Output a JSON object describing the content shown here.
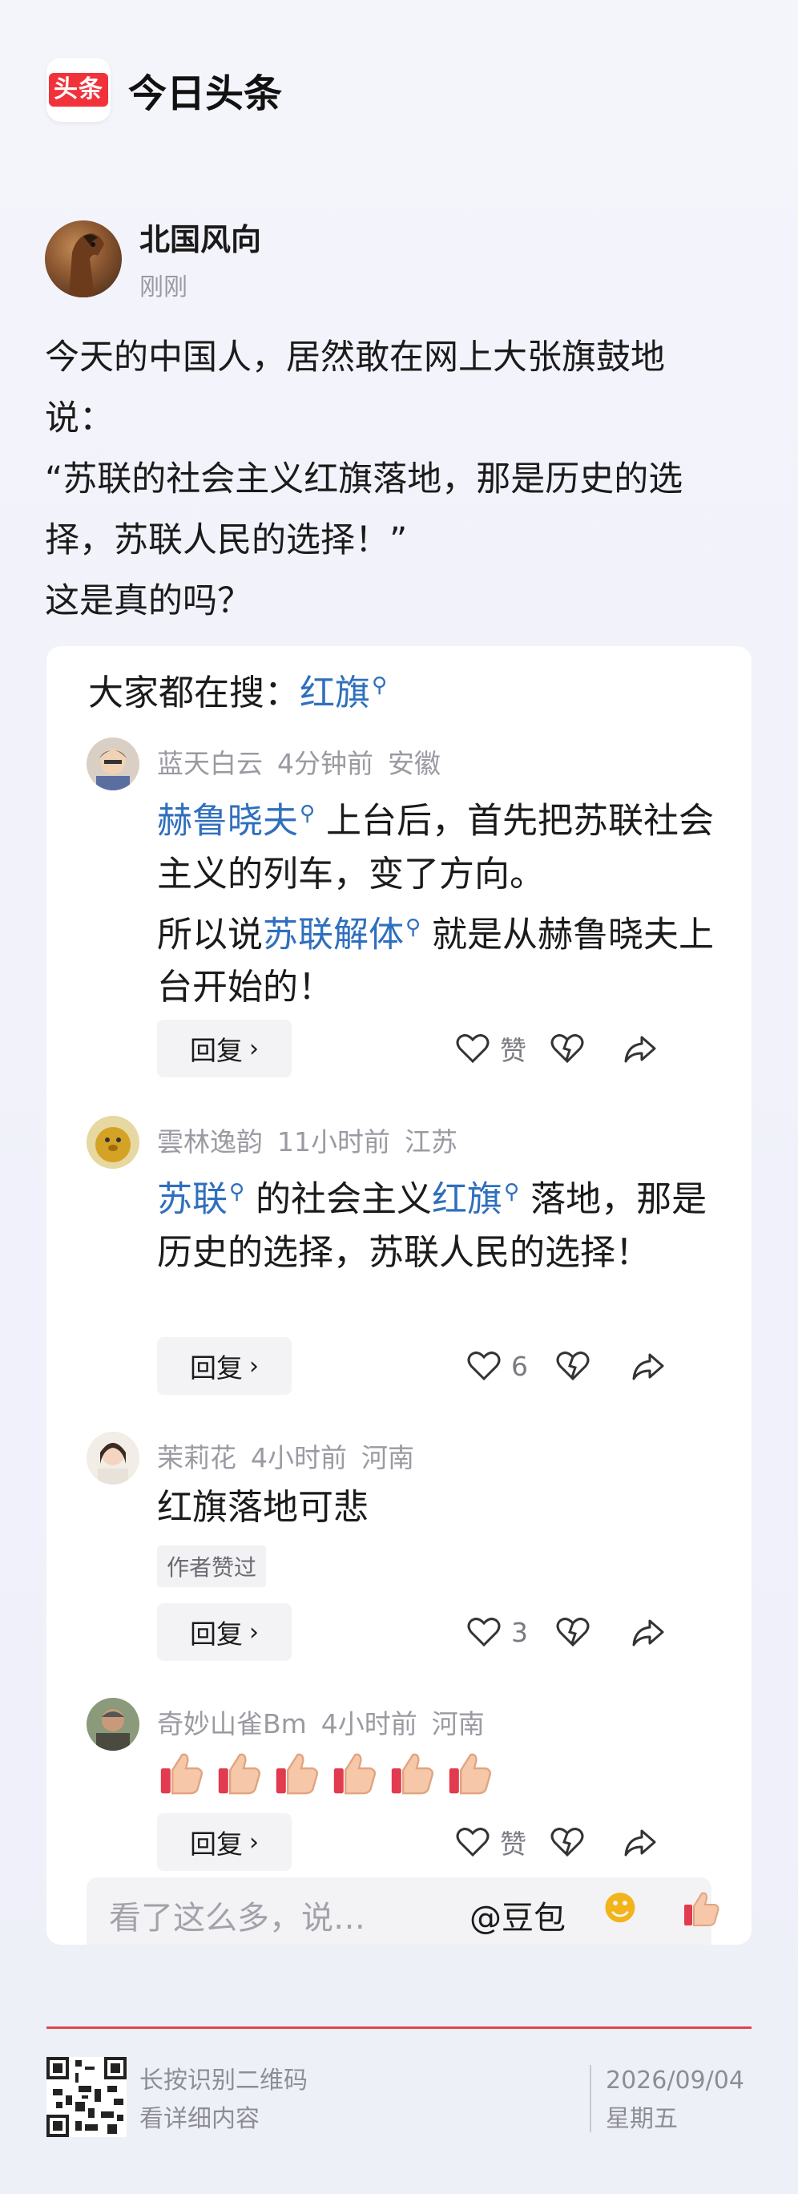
{
  "header": {
    "logo_text": "头条",
    "app_name": "今日头条"
  },
  "post": {
    "author_name": "北国风向",
    "time": "刚刚",
    "text": "今天的中国人，居然敢在网上大张旗鼓地\n说：\n“苏联的社会主义红旗落地，那是历史的选\n择，苏联人民的选择！”\n这是真的吗？"
  },
  "search": {
    "prefix": "大家都在搜：",
    "keyword": "红旗"
  },
  "comments": [
    {
      "user": "蓝天白云",
      "time": "4分钟前",
      "location": "安徽",
      "kw1": "赫鲁晓夫",
      "text1": " 上台后，首先把苏联社会主义的列车，变了方向。",
      "text2": "所以说",
      "kw2": "苏联解体",
      "text3": " 就是从赫鲁晓夫上台开始的！",
      "reply": "回复",
      "like": "赞"
    },
    {
      "user": "雲林逸韵",
      "time": "11小时前",
      "location": "江苏",
      "kw1": "苏联",
      "text1": " 的社会主义",
      "kw2": "红旗",
      "text2": " 落地，那是历史的选择，苏联人民的选择！",
      "reply": "回复",
      "like": "6"
    },
    {
      "user": "茉莉花",
      "time": "4小时前",
      "location": "河南",
      "text": "红旗落地可悲",
      "badge": "作者赞过",
      "reply": "回复",
      "like": "3"
    },
    {
      "user": "奇妙山雀Bm",
      "time": "4小时前",
      "location": "河南",
      "thumbs_count": 6,
      "reply": "回复",
      "like": "赞"
    }
  ],
  "input": {
    "placeholder": "看了这么多，说…",
    "mention": "@豆包"
  },
  "footer": {
    "qr_line1": "长按识别二维码",
    "qr_line2": "看详细内容",
    "date": "2026/09/04",
    "weekday": "星期五"
  },
  "colors": {
    "keyword": "#2f6fbd",
    "brand_red": "#f2323a",
    "divider": "#e4454d"
  }
}
